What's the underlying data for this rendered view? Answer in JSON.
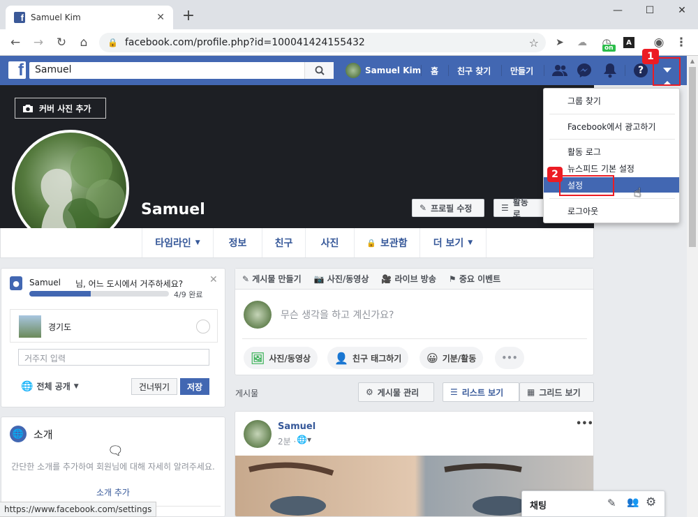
{
  "browser": {
    "tab_title": "Samuel Kim",
    "url": "facebook.com/profile.php?id=100041424155432",
    "new_tab_label": "+",
    "status_url": "https://www.facebook.com/settings",
    "ext_badge": "on"
  },
  "fbbar": {
    "search_value": "Samuel",
    "user_name": "Samuel Kim",
    "nav": [
      "홈",
      "친구 찾기",
      "만들기"
    ]
  },
  "dropdown": {
    "items": [
      "그룹 찾기",
      "Facebook에서 광고하기",
      "활동 로그",
      "뉴스피드 기본 설정",
      "설정",
      "로그아웃"
    ],
    "highlighted": "설정"
  },
  "markers": [
    "1",
    "2"
  ],
  "profile": {
    "cover_button": "커버 사진 추가",
    "name": "Samuel",
    "edit_profile": "프로필 수정",
    "activity_log": "활동 로",
    "tabs": [
      "타임라인",
      "정보",
      "친구",
      "사진",
      "보관함",
      "더 보기"
    ]
  },
  "city_card": {
    "name": "Samuel",
    "question": "님, 어느 도시에서 거주하세요?",
    "progress_label": "4/9 완료",
    "progress_fraction": 0.44,
    "suggestion": "경기도",
    "input_placeholder": "거주지 입력",
    "privacy": "전체 공개",
    "skip": "건너뛰기",
    "save": "저장"
  },
  "intro_card": {
    "title": "소개",
    "text": "간단한 소개를 추가하여 회원님에 대해 자세히 알려주세요.",
    "link": "소개 추가"
  },
  "composer": {
    "tabs": [
      "게시물 만들기",
      "사진/동영상",
      "라이브 방송",
      "중요 이벤트"
    ],
    "placeholder": "무슨 생각을 하고 계신가요?",
    "buttons": [
      "사진/동영상",
      "친구 태그하기",
      "기분/활동"
    ],
    "more": "•••"
  },
  "posts_bar": {
    "label": "게시물",
    "manage": "게시물 관리",
    "list_view": "리스트 보기",
    "grid_view": "그리드 보기"
  },
  "post": {
    "author": "Samuel",
    "time": "2분 ·",
    "more": "•••"
  },
  "chat": {
    "label": "채팅"
  },
  "colors": {
    "fb_blue": "#4267b2",
    "link_blue": "#365899",
    "highlight": "#4267b2",
    "marker_red": "#ec1c24"
  }
}
